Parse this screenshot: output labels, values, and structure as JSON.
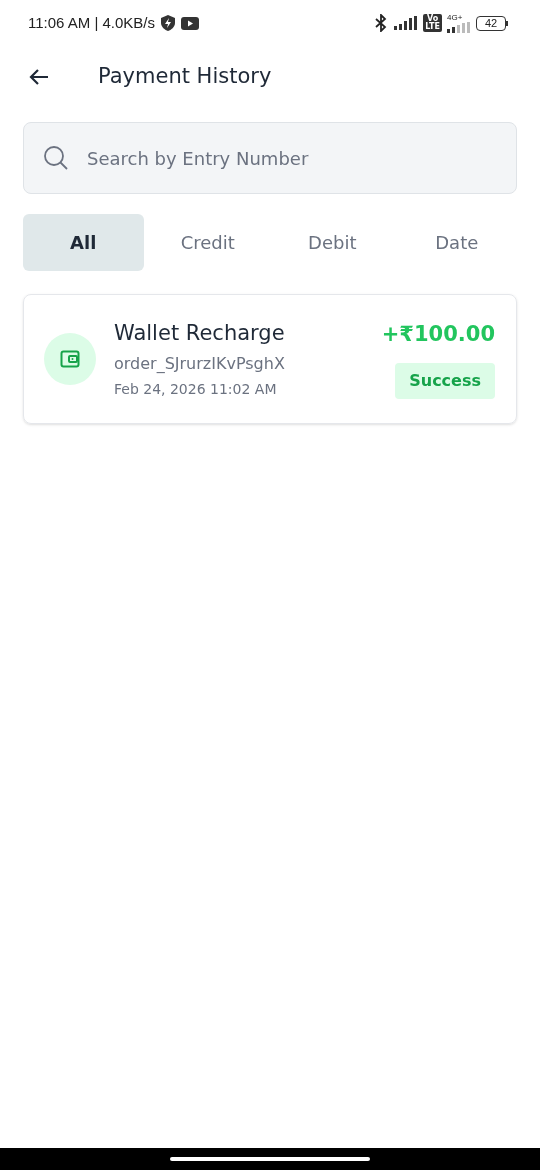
{
  "status_bar": {
    "time": "11:06 AM | 4.0KB/s",
    "volte": [
      "Vo",
      "LTE"
    ],
    "network": "4G+",
    "battery": "42"
  },
  "header": {
    "title": "Payment History"
  },
  "search": {
    "placeholder": "Search by Entry Number"
  },
  "tabs": [
    {
      "label": "All",
      "selected": true
    },
    {
      "label": "Credit",
      "selected": false
    },
    {
      "label": "Debit",
      "selected": false
    },
    {
      "label": "Date",
      "selected": false
    }
  ],
  "transactions": [
    {
      "title": "Wallet Recharge",
      "order_id": "order_SJrurzIKvPsghX",
      "date": "Feb 24, 2026 11:02 AM",
      "amount": "+₹100.00",
      "status": "Success"
    }
  ]
}
